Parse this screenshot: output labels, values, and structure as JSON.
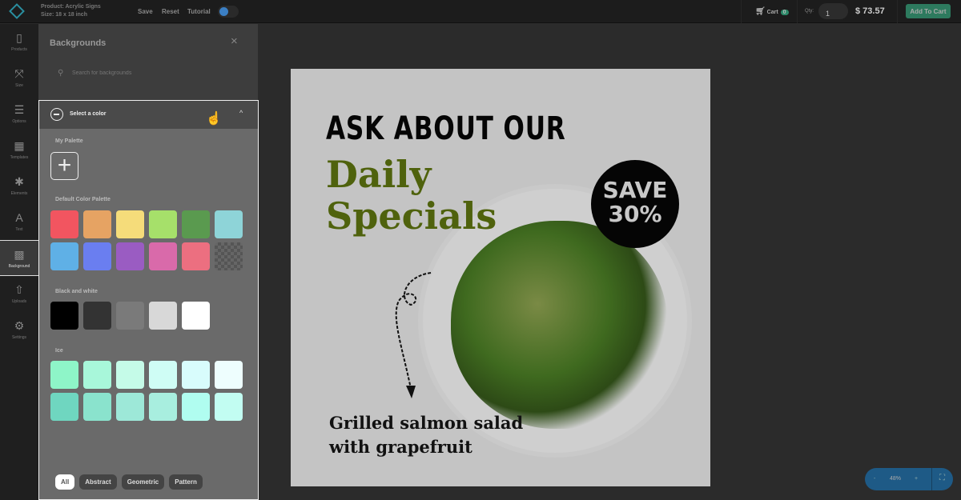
{
  "header": {
    "product": "Product: Acrylic Signs",
    "size": "Size: 18 x 18 inch",
    "save": "Save",
    "reset": "Reset",
    "tutorial": "Tutorial",
    "cart_label": "Cart",
    "cart_count": "0",
    "qty_label": "Qty:",
    "qty_value": "1",
    "price": "$ 73.57",
    "add_to_cart": "Add To Cart"
  },
  "sidebar": {
    "items": [
      {
        "label": "Products",
        "icon": "▯"
      },
      {
        "label": "Size",
        "icon": "⤧"
      },
      {
        "label": "Options",
        "icon": "☰"
      },
      {
        "label": "Templates",
        "icon": "▦"
      },
      {
        "label": "Elements",
        "icon": "✱"
      },
      {
        "label": "Text",
        "icon": "A"
      },
      {
        "label": "Background",
        "icon": "▩"
      },
      {
        "label": "Uploads",
        "icon": "⇧"
      },
      {
        "label": "Settings",
        "icon": "⚙"
      }
    ],
    "active": "Background"
  },
  "panel": {
    "title": "Backgrounds",
    "close": "×",
    "search_placeholder": "Search for backgrounds",
    "accordion_title": "Select a color",
    "sections": {
      "my_palette": "My Palette",
      "default": "Default Color Palette",
      "bw": "Black and white",
      "ice": "Ice"
    },
    "default_colors": [
      "#f25560",
      "#e6a363",
      "#f5dc7a",
      "#a6e06a",
      "#5a9a4f",
      "#8ed4d8",
      "#5fb0e6",
      "#6a7ef0",
      "#9a5cc2",
      "#d96aaa",
      "#ec6f80",
      "transparent"
    ],
    "bw_colors": [
      "#000000",
      "#333333",
      "#7a7a7a",
      "#d8d8d8",
      "#ffffff"
    ],
    "ice_colors": [
      "#8ef5c8",
      "#a8f7da",
      "#c5fbe8",
      "#cffdf5",
      "#d8fcfc",
      "#eefefe",
      "#6fd6c0",
      "#8ae3cd",
      "#9de8d8",
      "#a8eedf",
      "#b0fdf0",
      "#c2fdf2"
    ],
    "chips": [
      "All",
      "Abstract",
      "Geometric",
      "Pattern"
    ],
    "active_chip": "All"
  },
  "design": {
    "line1": "ASK ABOUT OUR",
    "line2": "Daily",
    "line3": "Specials",
    "badge1": "SAVE",
    "badge2": "30%",
    "caption1": "Grilled salmon salad",
    "caption2": "with grapefruit"
  },
  "zoom": {
    "minus": "-",
    "value": "48%",
    "plus": "+"
  },
  "colors": {
    "accent": "#2d7a5e",
    "zoom_bar": "#1e5a86"
  }
}
